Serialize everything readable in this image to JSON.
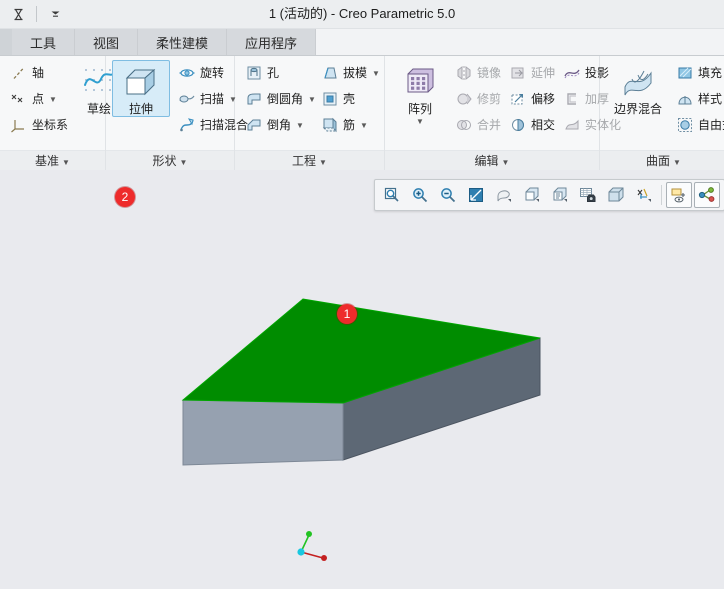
{
  "window": {
    "title": "1 (活动的) - Creo Parametric 5.0",
    "quick_access": [
      {
        "name": "hourglass-icon",
        "label": ""
      },
      {
        "name": "customize-quick-access-icon",
        "label": ""
      }
    ]
  },
  "tabs": [
    {
      "label": "工具",
      "name": "tab-tools"
    },
    {
      "label": "视图",
      "name": "tab-view"
    },
    {
      "label": "柔性建模",
      "name": "tab-flexible-modeling"
    },
    {
      "label": "应用程序",
      "name": "tab-applications"
    }
  ],
  "ribbon": {
    "groups": [
      {
        "label": "基准",
        "name": "group-datum",
        "small_items": [
          {
            "label": "轴",
            "icon": "axis-icon",
            "disabled": false,
            "dropdown": false
          },
          {
            "label": "点",
            "icon": "point-icon",
            "disabled": false,
            "dropdown": true
          },
          {
            "label": "坐标系",
            "icon": "coordinate-system-icon",
            "disabled": false,
            "dropdown": false
          }
        ],
        "big_items": [
          {
            "label": "草绘",
            "icon": "sketch-icon",
            "selected": false
          }
        ]
      },
      {
        "label": "形状",
        "name": "group-shapes",
        "big_items": [
          {
            "label": "拉伸",
            "icon": "extrude-icon",
            "selected": true,
            "badge": "2"
          }
        ],
        "small_items": [
          {
            "label": "旋转",
            "icon": "revolve-icon",
            "disabled": false,
            "dropdown": false
          },
          {
            "label": "扫描",
            "icon": "sweep-icon",
            "disabled": false,
            "dropdown": true
          },
          {
            "label": "扫描混合",
            "icon": "swept-blend-icon",
            "disabled": false,
            "dropdown": false
          }
        ]
      },
      {
        "label": "工程",
        "name": "group-engineering",
        "col_a": [
          {
            "label": "孔",
            "icon": "hole-icon",
            "disabled": false,
            "dropdown": false
          },
          {
            "label": "倒圆角",
            "icon": "round-icon",
            "disabled": false,
            "dropdown": true
          },
          {
            "label": "倒角",
            "icon": "chamfer-icon",
            "disabled": false,
            "dropdown": true
          }
        ],
        "col_b": [
          {
            "label": "拔模",
            "icon": "draft-icon",
            "disabled": false,
            "dropdown": true
          },
          {
            "label": "壳",
            "icon": "shell-icon",
            "disabled": false,
            "dropdown": false
          },
          {
            "label": "筋",
            "icon": "rib-icon",
            "disabled": false,
            "dropdown": true
          }
        ]
      },
      {
        "label": "编辑",
        "name": "group-edit",
        "big_items": [
          {
            "label": "阵列",
            "icon": "pattern-icon",
            "selected": false,
            "dropdown": true
          }
        ],
        "col_a": [
          {
            "label": "镜像",
            "icon": "mirror-icon",
            "disabled": true,
            "dropdown": false
          },
          {
            "label": "修剪",
            "icon": "trim-icon",
            "disabled": true,
            "dropdown": false
          },
          {
            "label": "合并",
            "icon": "merge-icon",
            "disabled": true,
            "dropdown": false
          }
        ],
        "col_b": [
          {
            "label": "延伸",
            "icon": "extend-icon",
            "disabled": true,
            "dropdown": false
          },
          {
            "label": "偏移",
            "icon": "offset-icon",
            "disabled": false,
            "dropdown": false
          },
          {
            "label": "相交",
            "icon": "intersect-icon",
            "disabled": false,
            "dropdown": false
          }
        ],
        "col_c": [
          {
            "label": "投影",
            "icon": "project-icon",
            "disabled": false,
            "dropdown": false
          },
          {
            "label": "加厚",
            "icon": "thicken-icon",
            "disabled": true,
            "dropdown": false
          },
          {
            "label": "实体化",
            "icon": "solidify-icon",
            "disabled": true,
            "dropdown": false
          }
        ]
      },
      {
        "label": "曲面",
        "name": "group-surfaces",
        "big_items": [
          {
            "label": "边界混合",
            "icon": "boundary-blend-icon",
            "selected": false
          }
        ],
        "small_items": [
          {
            "label": "填充",
            "icon": "fill-icon",
            "disabled": false,
            "dropdown": false
          },
          {
            "label": "样式",
            "icon": "style-icon",
            "disabled": false,
            "dropdown": false
          },
          {
            "label": "自由式",
            "icon": "freestyle-icon",
            "disabled": false,
            "dropdown": false
          }
        ]
      }
    ]
  },
  "view_toolbar": {
    "buttons": [
      {
        "name": "zoom-area-icon",
        "label": ""
      },
      {
        "name": "zoom-in-icon",
        "label": ""
      },
      {
        "name": "zoom-out-icon",
        "label": ""
      },
      {
        "name": "refit-icon",
        "label": ""
      },
      {
        "name": "reorient-icon",
        "label": ""
      },
      {
        "name": "saved-views-icon",
        "label": ""
      },
      {
        "name": "view-manager-icon",
        "label": ""
      },
      {
        "name": "named-view-camera-icon",
        "label": ""
      },
      {
        "name": "display-style-icon",
        "label": ""
      },
      {
        "name": "datum-display-filters-icon",
        "label": ""
      },
      {
        "name": "annotation-display-icon",
        "label": ""
      },
      {
        "name": "appearance-gallery-icon",
        "label": ""
      }
    ]
  },
  "graphics": {
    "background_color": "#e9eaee",
    "model": {
      "name": "extruded-block",
      "top_face_color": "#008c00",
      "left_face_color": "#96a1b0",
      "right_face_color": "#5d6875",
      "selected_face": "top",
      "badge": "1"
    },
    "coordinate_triad": {
      "name": "coordinate-triad",
      "origin_color": "#18c8e0",
      "y_axis_color": "#22c322",
      "x_axis_color": "#c42020"
    }
  }
}
